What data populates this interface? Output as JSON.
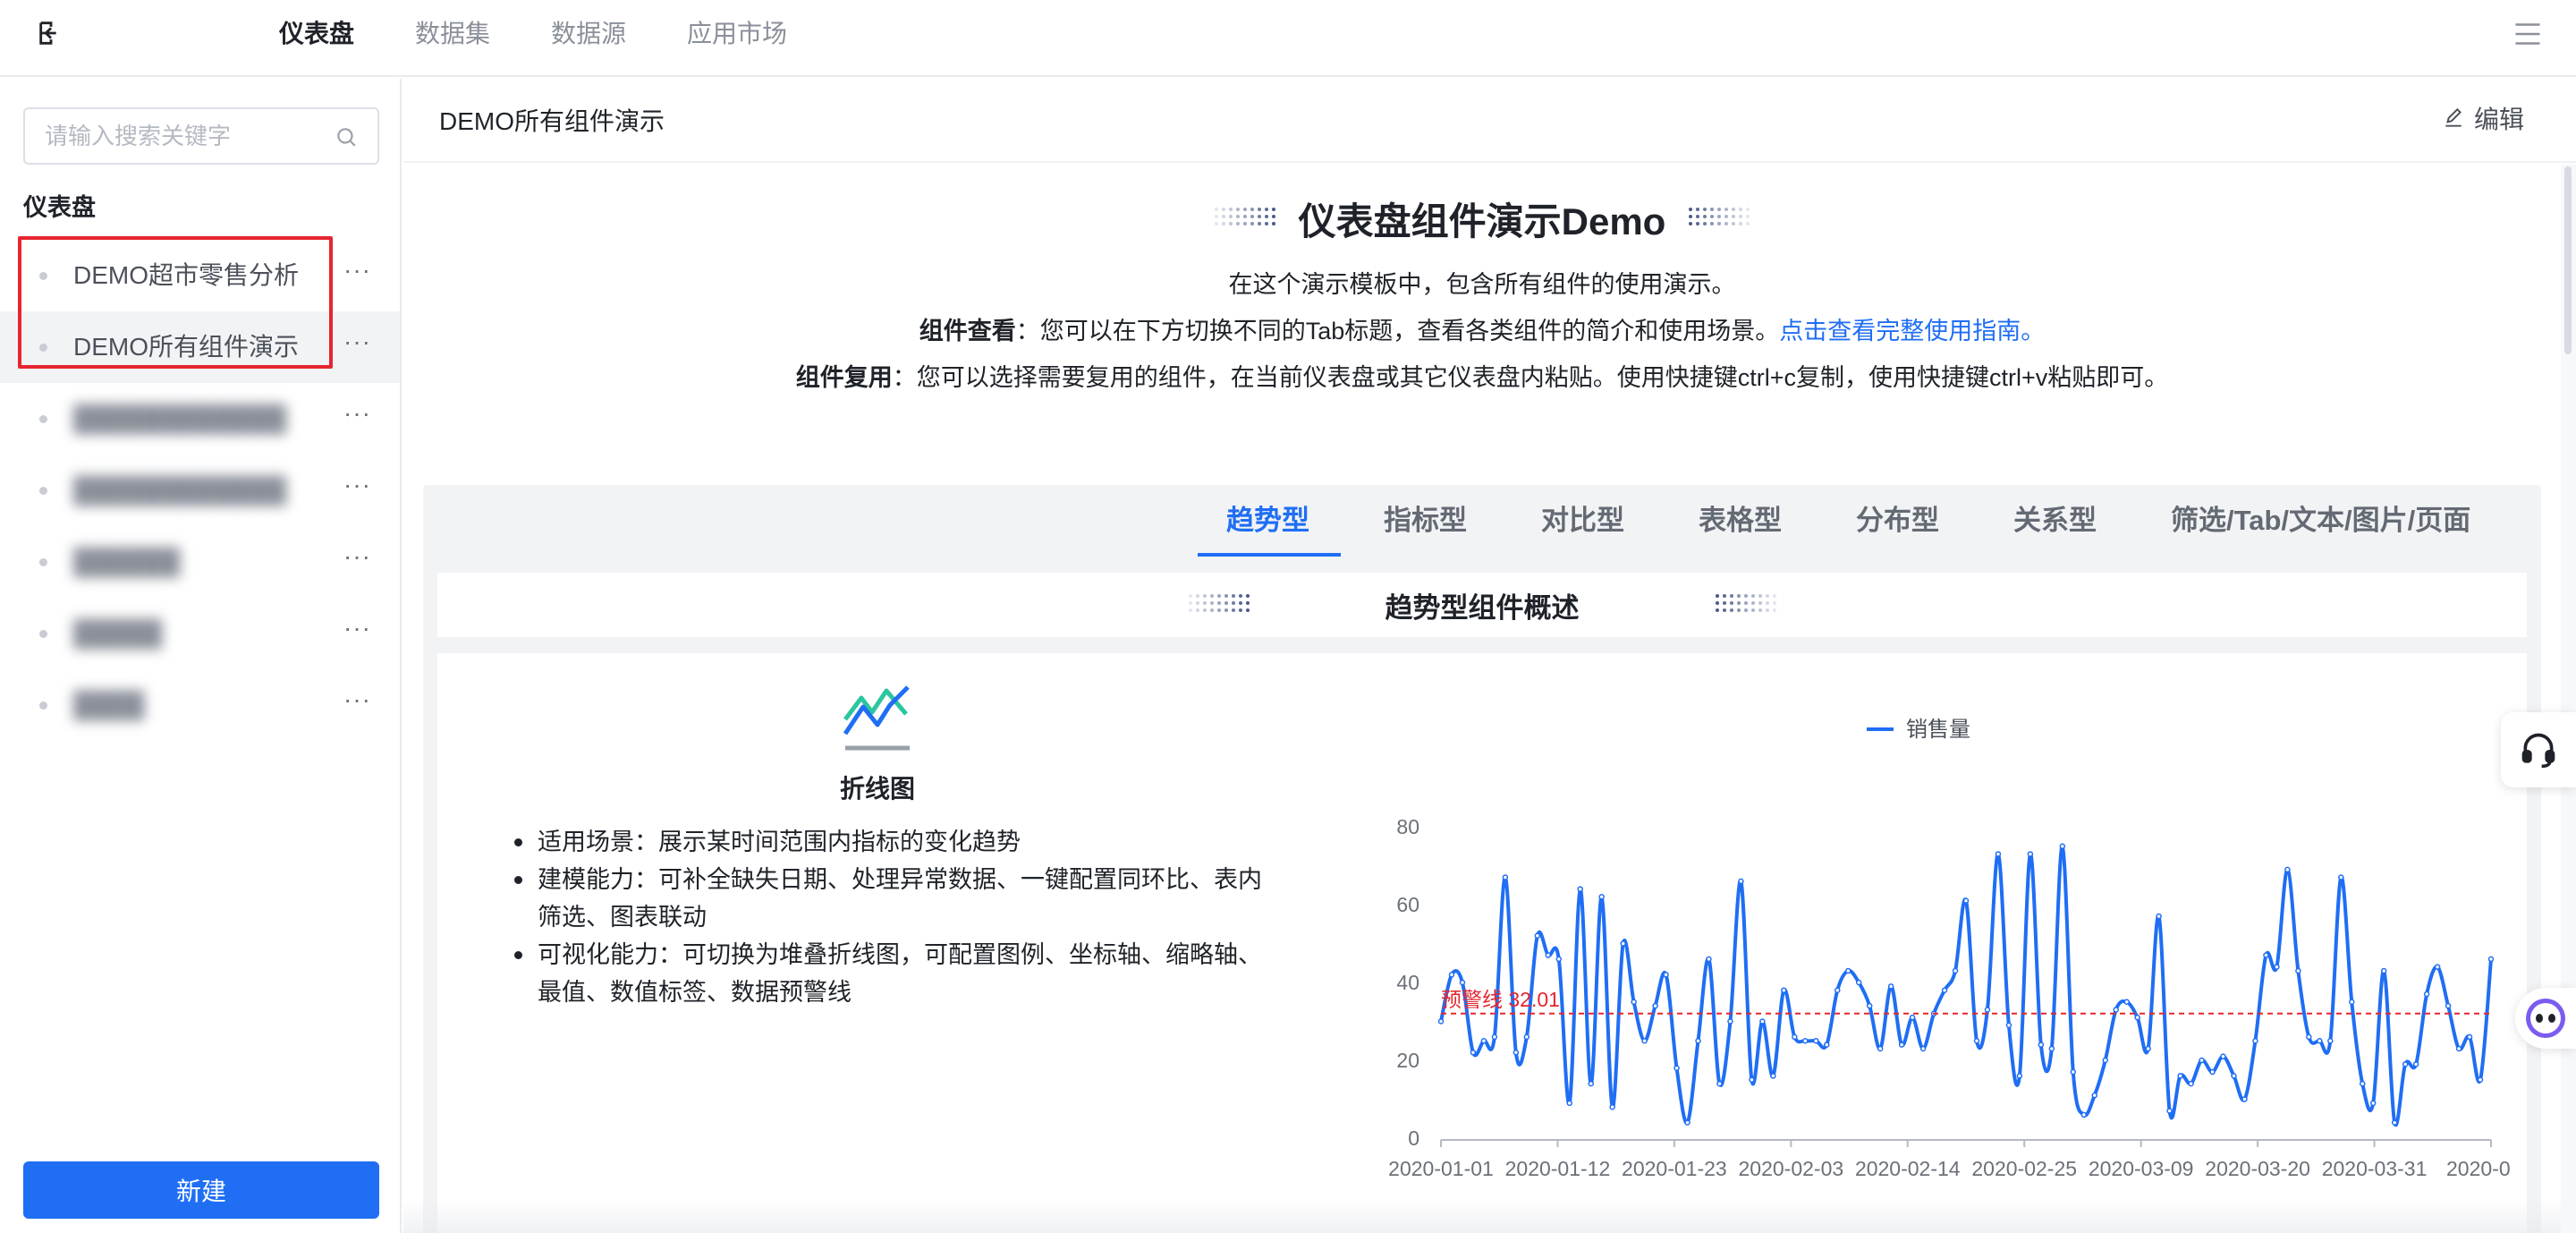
{
  "topnav": {
    "tabs": [
      "仪表盘",
      "数据集",
      "数据源",
      "应用市场"
    ],
    "active_index": 0
  },
  "sidebar": {
    "search_placeholder": "请输入搜索关键字",
    "section_title": "仪表盘",
    "items": [
      {
        "label": "DEMO超市零售分析",
        "more": "···"
      },
      {
        "label": "DEMO所有组件演示",
        "more": "···"
      },
      {
        "label": "",
        "more": "···"
      },
      {
        "label": "",
        "more": "···"
      },
      {
        "label": "",
        "more": "···"
      },
      {
        "label": "",
        "more": "···"
      },
      {
        "label": "",
        "more": "···"
      }
    ],
    "selected_index": 1,
    "new_button": "新建"
  },
  "header": {
    "title": "DEMO所有组件演示",
    "edit_label": "编辑"
  },
  "hero": {
    "title": "仪表盘组件演示Demo",
    "line1": "在这个演示模板中，包含所有组件的使用演示。",
    "line2_bold": "组件查看",
    "line2_text": "：您可以在下方切换不同的Tab标题，查看各类组件的简介和使用场景。",
    "line2_link": "点击查看完整使用指南。",
    "line3_bold": "组件复用",
    "line3_text": "：您可以选择需要复用的组件，在当前仪表盘或其它仪表盘内粘贴。使用快捷键ctrl+c复制，使用快捷键ctrl+v粘贴即可。"
  },
  "tabs": {
    "items": [
      "趋势型",
      "指标型",
      "对比型",
      "表格型",
      "分布型",
      "关系型",
      "筛选/Tab/文本/图片/页面"
    ],
    "active_index": 0
  },
  "section": {
    "title": "趋势型组件概述"
  },
  "card": {
    "heading": "折线图",
    "features": [
      "适用场景：展示某时间范围内指标的变化趋势",
      "建模能力：可补全缺失日期、处理异常数据、一键配置同环比、表内筛选、图表联动",
      "可视化能力：可切换为堆叠折线图，可配置图例、坐标轴、缩略轴、最值、数值标签、数据预警线"
    ]
  },
  "chart_data": {
    "type": "line",
    "series": [
      {
        "name": "销售量",
        "values": [
          30,
          42,
          40,
          22,
          25,
          26,
          67,
          22,
          26,
          52,
          47,
          46,
          9,
          64,
          14,
          62,
          8,
          50,
          35,
          25,
          34,
          42,
          18,
          4,
          25,
          46,
          14,
          30,
          66,
          15,
          30,
          16,
          38,
          26,
          25,
          25,
          24,
          38,
          43,
          40,
          34,
          23,
          39,
          24,
          31,
          23,
          32,
          38,
          43,
          61,
          25,
          33,
          73,
          29,
          16,
          73,
          24,
          23,
          75,
          17,
          6,
          11,
          20,
          33,
          35,
          31,
          23,
          57,
          7,
          16,
          14,
          20,
          17,
          21,
          16,
          10,
          25,
          47,
          44,
          69,
          43,
          26,
          25,
          25,
          67,
          35,
          14,
          9,
          43,
          4,
          19,
          19,
          37,
          44,
          34,
          23,
          26,
          15,
          46
        ]
      }
    ],
    "x_start": "2020-01-01",
    "x_tick_labels": [
      "2020-01-01",
      "2020-01-12",
      "2020-01-23",
      "2020-02-03",
      "2020-02-14",
      "2020-02-25",
      "2020-03-09",
      "2020-03-20",
      "2020-03-31",
      "2020-0"
    ],
    "ylim": [
      0,
      80
    ],
    "y_ticks": [
      0,
      20,
      40,
      60,
      80
    ],
    "warning_line": {
      "value": 32.01,
      "label": "预警线 32.01"
    },
    "legend_position": "top",
    "grid": false,
    "line_color": "#1f6ef4",
    "warning_color": "#e5262f"
  }
}
